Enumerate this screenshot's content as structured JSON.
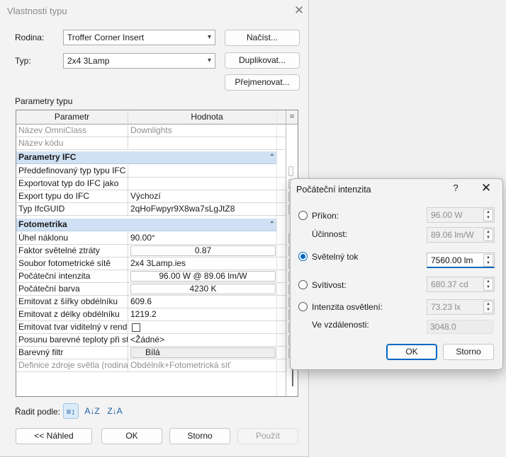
{
  "main_dialog": {
    "title": "Vlastnosti typu",
    "family_label": "Rodina:",
    "family_value": "Troffer Corner Insert",
    "type_label": "Typ:",
    "type_value": "2x4 3Lamp",
    "load_button": "Načíst...",
    "duplicate_button": "Duplikovat...",
    "rename_button": "Přejmenovat...",
    "params_label": "Parametry typu",
    "grid": {
      "col_param": "Parametr",
      "col_value": "Hodnota",
      "col_ext": "=",
      "rows": [
        {
          "param": "Název OmniClass",
          "value": "Downlights"
        },
        {
          "param": "Název kódu",
          "value": ""
        },
        {
          "group": "Parametry IFC",
          "chevron": "⌃"
        },
        {
          "param": "Předdefinovaný typ typu IFC",
          "value": ""
        },
        {
          "param": "Exportovat typ do IFC jako",
          "value": ""
        },
        {
          "param": "Export typu do IFC",
          "value": "Výchozí"
        },
        {
          "param": "Typ IfcGUID",
          "value": "2qHoFwpyr9X8wa7sLgJtZ8"
        },
        {
          "group": "Fotometrika",
          "chevron": "⌃"
        },
        {
          "param": "Úhel náklonu",
          "value": "90.00°"
        },
        {
          "param": "Faktor světelné ztráty",
          "value": "0.87"
        },
        {
          "param": "Soubor fotometrické sítě",
          "value": "2x4 3Lamp.ies"
        },
        {
          "param": "Počáteční intenzita",
          "value": "96.00 W @ 89.06 lm/W"
        },
        {
          "param": "Počáteční barva",
          "value": "4230 K"
        },
        {
          "param": "Emitovat z šířky obdélníku",
          "value": "609.6"
        },
        {
          "param": "Emitovat z délky obdélníku",
          "value": "1219.2"
        },
        {
          "param": "Emitovat tvar viditelný v rend",
          "value": ""
        },
        {
          "param": "Posunu barevné teploty při st",
          "value": "<Žádné>"
        },
        {
          "param": "Barevný filtr",
          "value": "Bílá"
        },
        {
          "param": "Definice zdroje světla (rodina",
          "value": "Obdélník+Fotometrická síť"
        }
      ]
    },
    "sort_label": "Řadit podle:",
    "sort_icons": {
      "category": "≡↕",
      "az": "A↓Z",
      "za": "Z↓A"
    },
    "preview_button": "<< Náhled",
    "ok_button": "OK",
    "cancel_button": "Storno",
    "apply_button": "Použít"
  },
  "sub_dialog": {
    "title": "Počáteční intenzita",
    "help": "?",
    "close": "✕",
    "wattage_label": "Příkon:",
    "wattage_value": "96.00 W",
    "efficacy_label": "Účinnost:",
    "efficacy_value": "89.06 lm/W",
    "flux_label": "Světelný tok",
    "flux_value": "7560.00 lm",
    "intensity_label": "Svítivost:",
    "intensity_value": "680.37 cd",
    "illuminance_label": "Intenzita osvětlení:",
    "illuminance_value": "73.23 lx",
    "distance_label": "Ve vzdálenosti:",
    "distance_value": "3048.0",
    "ok_button": "OK",
    "cancel_button": "Storno",
    "selected_option": "flux"
  },
  "colors": {
    "accent": "#0067c0",
    "group_row": "#cfe1f3"
  }
}
